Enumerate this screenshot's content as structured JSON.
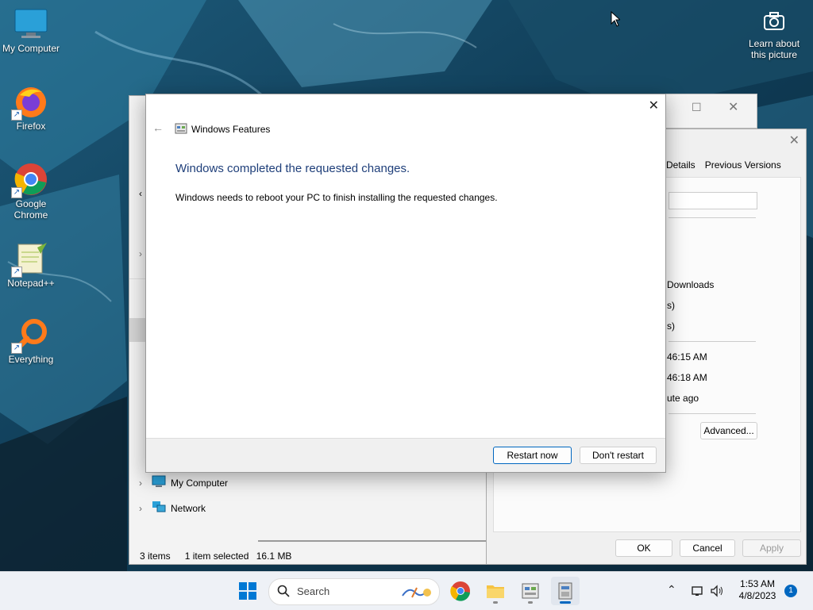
{
  "desktop": {
    "icons": [
      {
        "label": "My Computer"
      },
      {
        "label": "Firefox"
      },
      {
        "label": "Google Chrome"
      },
      {
        "label": "Notepad++"
      },
      {
        "label": "Everything"
      }
    ],
    "learn_label": "Learn about this picture"
  },
  "explorer": {
    "tree": [
      {
        "label": "My Computer"
      },
      {
        "label": "Network"
      }
    ],
    "status": {
      "items": "3 items",
      "selected": "1 item selected",
      "size": "16.1 MB"
    }
  },
  "properties": {
    "tabs": [
      {
        "label": "Details"
      },
      {
        "label": "Previous Versions"
      }
    ],
    "fields": [
      "Downloads",
      "s)",
      "s)",
      "46:15 AM",
      "46:18 AM",
      "ute ago"
    ],
    "advanced_label": "Advanced...",
    "ok_label": "OK",
    "cancel_label": "Cancel",
    "apply_label": "Apply"
  },
  "dialog": {
    "title": "Windows Features",
    "heading": "Windows completed the requested changes.",
    "body": "Windows needs to reboot your PC to finish installing the requested changes.",
    "restart_label": "Restart now",
    "dont_restart_label": "Don't restart"
  },
  "taskbar": {
    "search_placeholder": "Search",
    "time": "1:53 AM",
    "date": "4/8/2023",
    "notification_count": "1"
  },
  "colors": {
    "accent": "#0067c0",
    "heading": "#1f3f7a"
  }
}
